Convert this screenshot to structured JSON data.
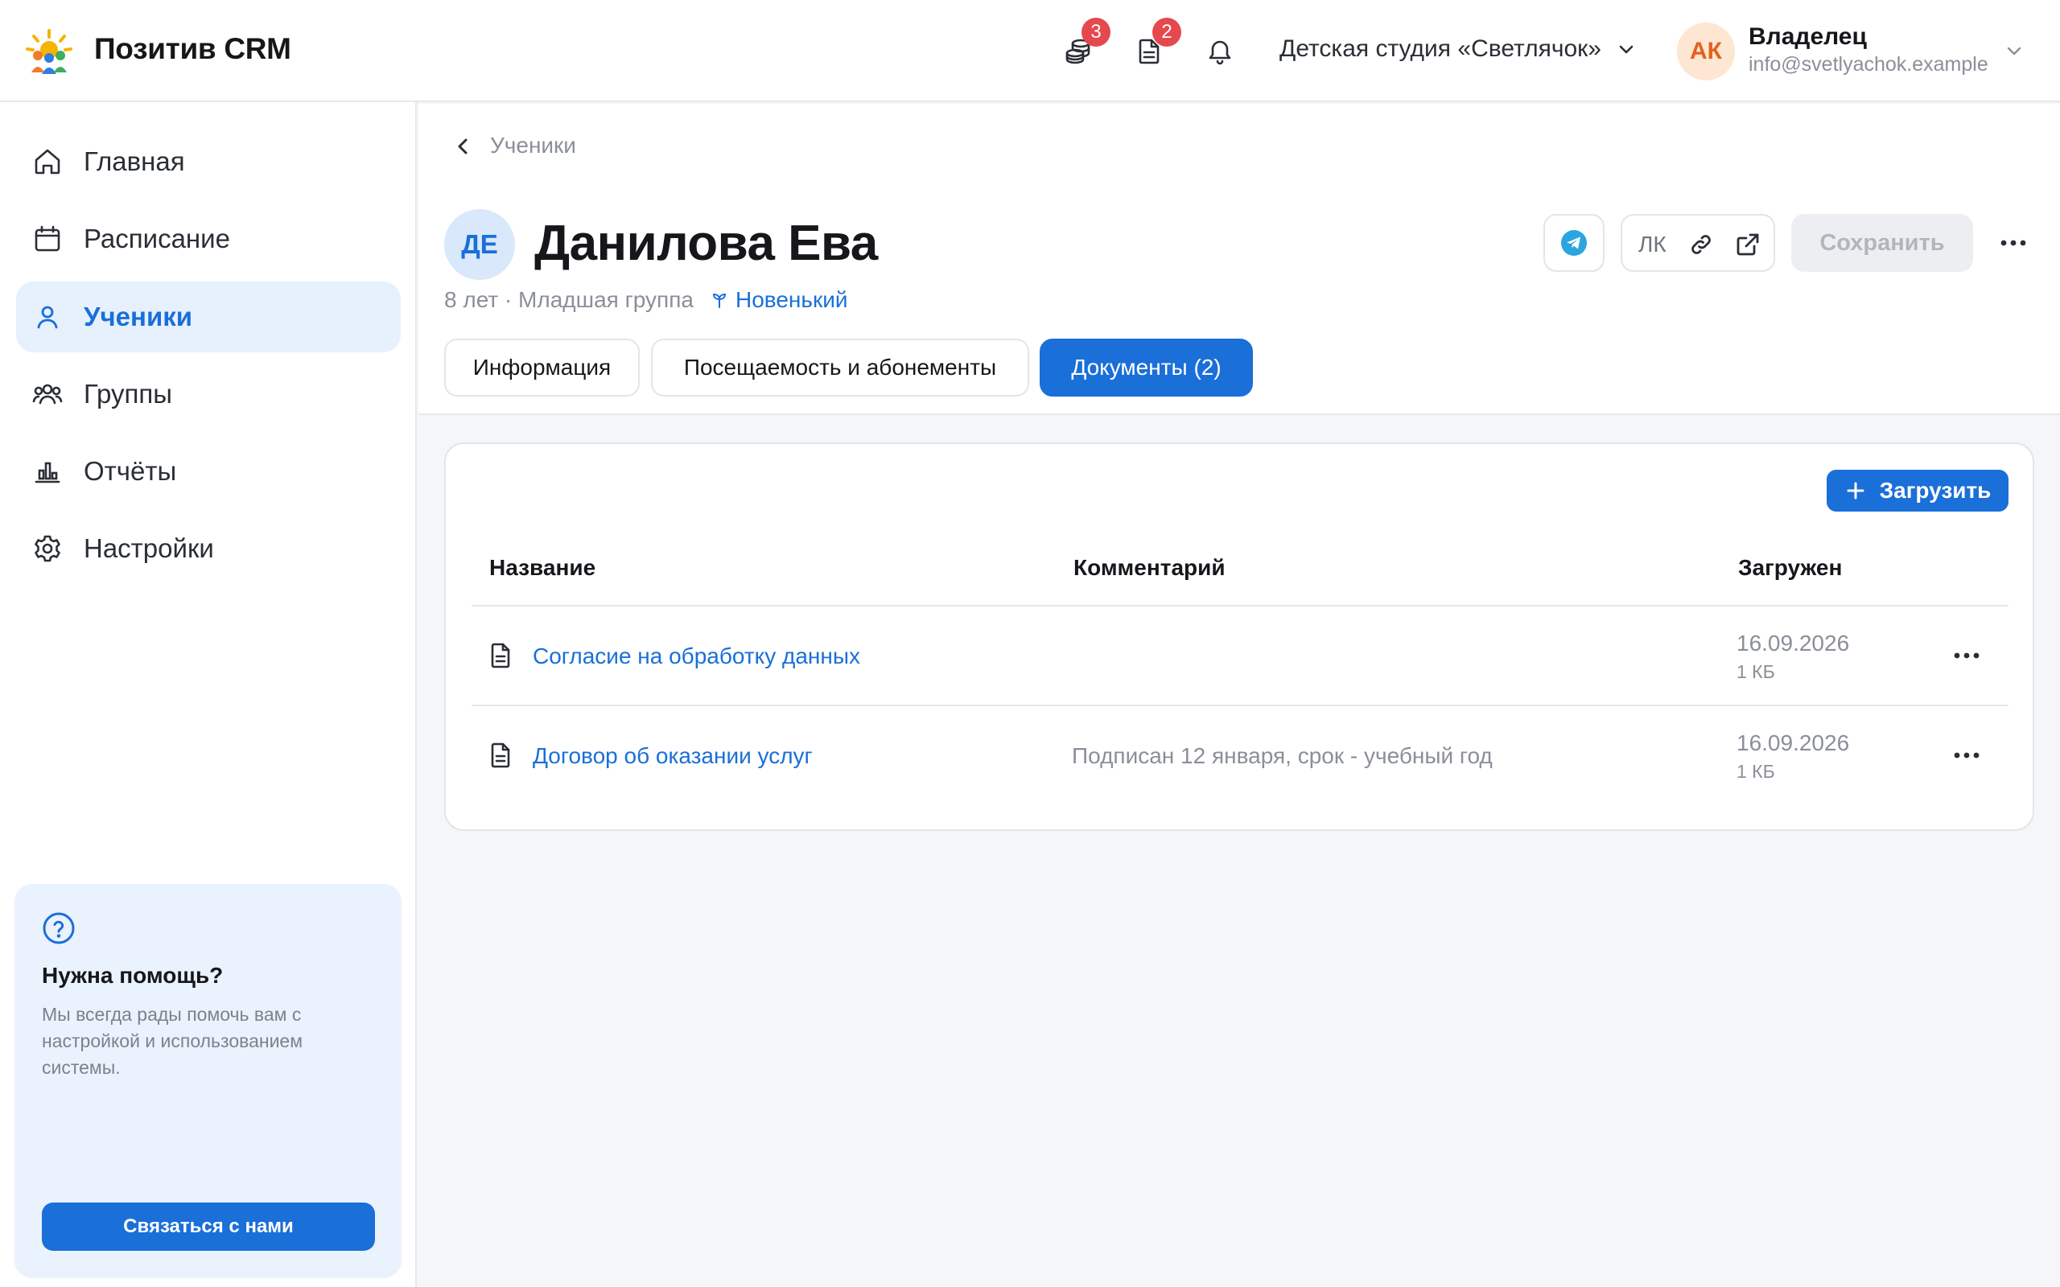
{
  "app": {
    "name": "Позитив CRM"
  },
  "topbar": {
    "payments_badge": "3",
    "documents_badge": "2",
    "organization": "Детская студия «Светлячок»",
    "user": {
      "initials": "АК",
      "role": "Владелец",
      "email": "info@svetlyachok.example"
    }
  },
  "sidebar": {
    "items": [
      {
        "label": "Главная",
        "icon": "home-icon"
      },
      {
        "label": "Расписание",
        "icon": "calendar-icon"
      },
      {
        "label": "Ученики",
        "icon": "user-icon",
        "active": true
      },
      {
        "label": "Группы",
        "icon": "users-icon"
      },
      {
        "label": "Отчёты",
        "icon": "chart-icon"
      },
      {
        "label": "Настройки",
        "icon": "gear-icon"
      }
    ],
    "help": {
      "title": "Нужна помощь?",
      "text": "Мы всегда рады помочь вам с настройкой и использованием системы.",
      "button": "Связаться с нами"
    }
  },
  "breadcrumb": "Ученики",
  "student": {
    "initials": "ДЕ",
    "name": "Данилова Ева",
    "meta": "8 лет · Младшая группа",
    "tag": "Новенький"
  },
  "actions": {
    "lk_label": "ЛК",
    "save_label": "Сохранить"
  },
  "tabs": [
    {
      "label": "Информация"
    },
    {
      "label": "Посещаемость и абонементы"
    },
    {
      "label": "Документы (2)",
      "active": true
    }
  ],
  "documents": {
    "upload_label": "Загрузить",
    "columns": [
      "Название",
      "Комментарий",
      "Загружен"
    ],
    "rows": [
      {
        "name": "Согласие на обработку данных",
        "comment": "",
        "date": "16.09.2026",
        "size": "1 КБ"
      },
      {
        "name": "Договор об оказании услуг",
        "comment": "Подписан 12 января, срок - учебный год",
        "date": "16.09.2026",
        "size": "1 КБ"
      }
    ]
  },
  "colors": {
    "accent": "#1a6fd8",
    "badge": "#e5484d",
    "active_nav_bg": "#e7f0fd"
  }
}
